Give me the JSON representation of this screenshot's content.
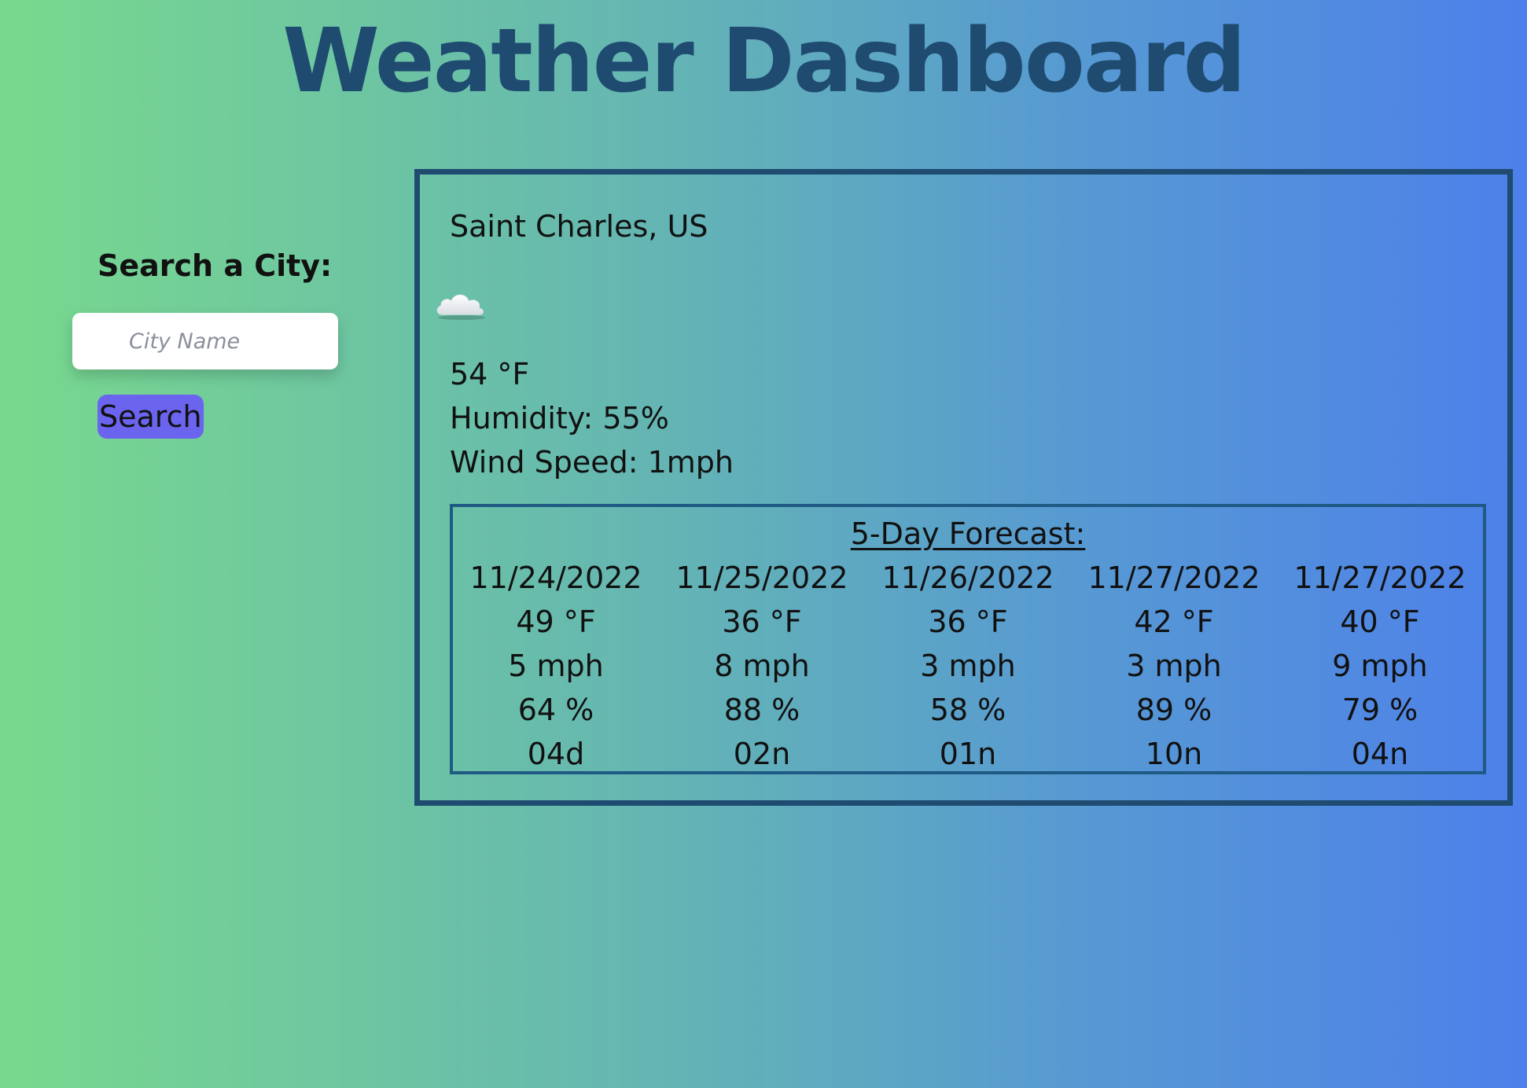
{
  "header": {
    "title": "Weather Dashboard"
  },
  "sidebar": {
    "label": "Search a City:",
    "input_placeholder": "City Name",
    "input_value": "",
    "button_label": "Search"
  },
  "current": {
    "city": "Saint Charles, US",
    "icon": "cloud-icon",
    "temp": "54 °F",
    "humidity": "Humidity: 55%",
    "wind": "Wind Speed: 1mph"
  },
  "forecast": {
    "title": "5-Day Forecast:",
    "days": [
      {
        "date": "11/24/2022",
        "temp": "49 °F",
        "wind": "5 mph",
        "humidity": "64 %",
        "icon_code": "04d"
      },
      {
        "date": "11/25/2022",
        "temp": "36 °F",
        "wind": "8 mph",
        "humidity": "88 %",
        "icon_code": "02n"
      },
      {
        "date": "11/26/2022",
        "temp": "36 °F",
        "wind": "3 mph",
        "humidity": "58 %",
        "icon_code": "01n"
      },
      {
        "date": "11/27/2022",
        "temp": "42 °F",
        "wind": "3 mph",
        "humidity": "89 %",
        "icon_code": "10n"
      },
      {
        "date": "11/27/2022",
        "temp": "40 °F",
        "wind": "9 mph",
        "humidity": "79 %",
        "icon_code": "04n"
      }
    ]
  },
  "colors": {
    "title": "#1f4b70",
    "card_border": "#1f4b70",
    "button": "#6a64ee",
    "gradient_start": "#78d98d",
    "gradient_end": "#4d80ea"
  }
}
